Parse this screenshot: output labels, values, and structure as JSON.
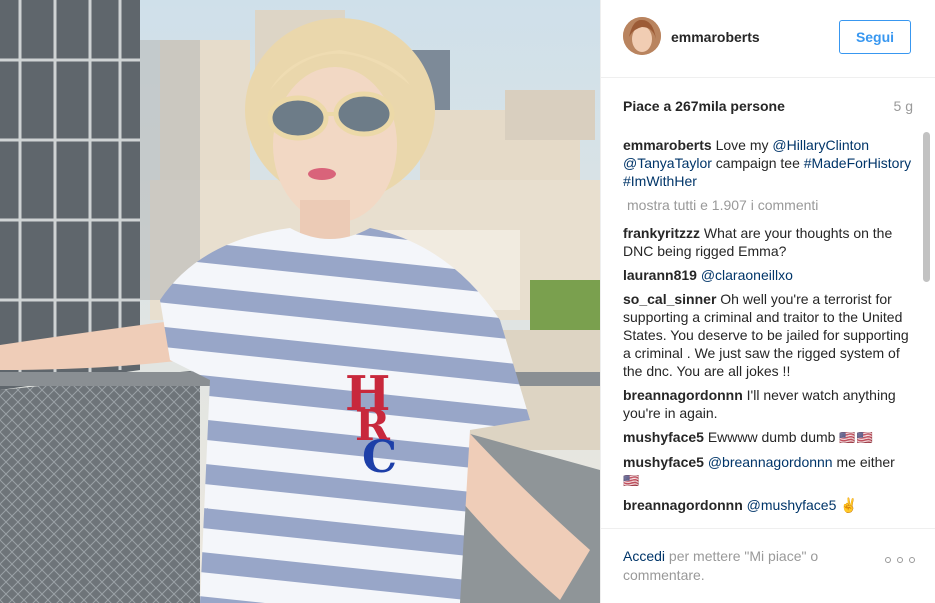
{
  "post": {
    "photo_alt": "",
    "user": "emmaroberts",
    "follow_label": "Segui",
    "likes_text": "Piace a 267mila persone",
    "age": "5 g"
  },
  "caption": {
    "user": "emmaroberts",
    "text_prefix": "Love my ",
    "mention1": "@HillaryClinton",
    "mention2": "@TanyaTaylor",
    "text_middle": " campaign tee ",
    "tag1": "#MadeForHistory",
    "tag2": "#ImWithHer"
  },
  "view_all": "mostra tutti e 1.907 i commenti",
  "comments": [
    {
      "user": "frankyritzzz",
      "text": "What are your thoughts on the DNC being rigged Emma?"
    },
    {
      "user": "laurann819",
      "mention": "@claraoneillxo",
      "text": ""
    },
    {
      "user": "so_cal_sinner",
      "text": "Oh well you're a terrorist for supporting a criminal and traitor to the United States. You deserve to be jailed for supporting a criminal . We just saw the rigged system of the dnc. You are all jokes !!"
    },
    {
      "user": "breannagordonnn",
      "text": "I'll never watch anything you're in again."
    },
    {
      "user": "mushyface5",
      "text": "Ewwww dumb dumb",
      "emoji": "🇺🇸🇺🇸"
    },
    {
      "user": "mushyface5",
      "mention": "@breannagordonnn",
      "text": " me either",
      "emoji": "🇺🇸"
    },
    {
      "user": "breannagordonnn",
      "mention": "@mushyface5",
      "text": " ✌"
    }
  ],
  "footer": {
    "login_label": "Accedi",
    "login_suffix": " per mettere \"Mi piace\" o commentare."
  },
  "icons": {
    "more": "more-options-icon"
  },
  "colors": {
    "link": "#003569",
    "accent": "#3897f0",
    "muted": "#999999"
  }
}
